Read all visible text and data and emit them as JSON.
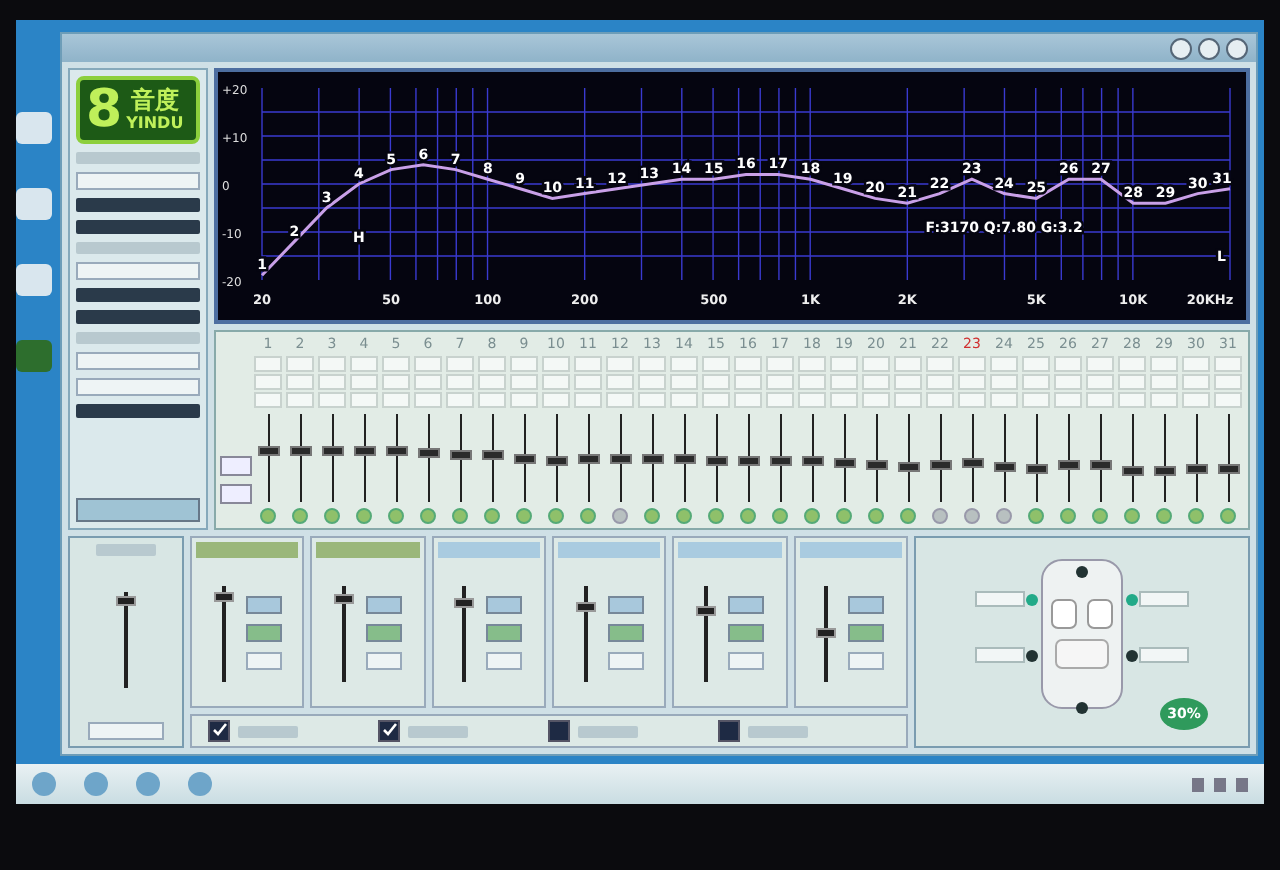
{
  "logo": {
    "digit": "8",
    "name": "音度",
    "latin": "YINDU"
  },
  "eq_chart": {
    "chart_data": {
      "type": "line",
      "categories": [
        "1",
        "2",
        "3",
        "4",
        "5",
        "6",
        "7",
        "8",
        "9",
        "10",
        "11",
        "12",
        "13",
        "14",
        "15",
        "16",
        "17",
        "18",
        "19",
        "20",
        "21",
        "22",
        "23",
        "24",
        "25",
        "26",
        "27",
        "28",
        "29",
        "30",
        "31"
      ],
      "series": [
        {
          "color": "#c9a0e8",
          "values": [
            -19,
            -12,
            -5,
            0,
            3,
            4,
            3,
            1,
            -1,
            -3,
            -2,
            -1,
            0,
            1,
            1,
            2,
            2,
            1,
            -1,
            -3,
            -4,
            -2,
            1,
            -2,
            -3,
            1,
            1,
            -4,
            -4,
            -2,
            -1
          ]
        }
      ],
      "ylim": [
        -20,
        20
      ],
      "grid": true,
      "yticks": [
        {
          "value": 20,
          "label": "+20"
        },
        {
          "value": 10,
          "label": "+10"
        },
        {
          "value": 0,
          "label": "0"
        },
        {
          "value": -10,
          "label": "-10"
        },
        {
          "value": -20,
          "label": "-20"
        }
      ],
      "annotations": [
        "H",
        "F:3170 Q:7.80 G:3.2",
        "L"
      ]
    },
    "frequency_labels": [
      "20",
      "50",
      "100",
      "200",
      "500",
      "1K",
      "2K",
      "5K",
      "10K",
      "20KHz"
    ]
  },
  "bands": [
    {
      "number": "1",
      "selected": false,
      "on": true,
      "level": 0.58
    },
    {
      "number": "2",
      "selected": false,
      "on": true,
      "level": 0.58
    },
    {
      "number": "3",
      "selected": false,
      "on": true,
      "level": 0.58
    },
    {
      "number": "4",
      "selected": false,
      "on": true,
      "level": 0.58
    },
    {
      "number": "5",
      "selected": false,
      "on": true,
      "level": 0.58
    },
    {
      "number": "6",
      "selected": false,
      "on": true,
      "level": 0.57
    },
    {
      "number": "7",
      "selected": false,
      "on": true,
      "level": 0.55
    },
    {
      "number": "8",
      "selected": false,
      "on": true,
      "level": 0.53
    },
    {
      "number": "9",
      "selected": false,
      "on": true,
      "level": 0.5
    },
    {
      "number": "10",
      "selected": false,
      "on": true,
      "level": 0.47
    },
    {
      "number": "11",
      "selected": false,
      "on": true,
      "level": 0.48
    },
    {
      "number": "12",
      "selected": false,
      "on": false,
      "level": 0.48
    },
    {
      "number": "13",
      "selected": false,
      "on": true,
      "level": 0.48
    },
    {
      "number": "14",
      "selected": false,
      "on": true,
      "level": 0.49
    },
    {
      "number": "15",
      "selected": false,
      "on": true,
      "level": 0.47
    },
    {
      "number": "16",
      "selected": false,
      "on": true,
      "level": 0.47
    },
    {
      "number": "17",
      "selected": false,
      "on": true,
      "level": 0.47
    },
    {
      "number": "18",
      "selected": false,
      "on": true,
      "level": 0.45
    },
    {
      "number": "19",
      "selected": false,
      "on": true,
      "level": 0.43
    },
    {
      "number": "20",
      "selected": false,
      "on": true,
      "level": 0.41
    },
    {
      "number": "21",
      "selected": false,
      "on": true,
      "level": 0.39
    },
    {
      "number": "22",
      "selected": false,
      "on": false,
      "level": 0.41
    },
    {
      "number": "23",
      "selected": true,
      "on": false,
      "level": 0.43
    },
    {
      "number": "24",
      "selected": false,
      "on": false,
      "level": 0.38
    },
    {
      "number": "25",
      "selected": false,
      "on": true,
      "level": 0.36
    },
    {
      "number": "26",
      "selected": false,
      "on": true,
      "level": 0.4
    },
    {
      "number": "27",
      "selected": false,
      "on": true,
      "level": 0.4
    },
    {
      "number": "28",
      "selected": false,
      "on": true,
      "level": 0.33
    },
    {
      "number": "29",
      "selected": false,
      "on": true,
      "level": 0.33
    },
    {
      "number": "30",
      "selected": false,
      "on": true,
      "level": 0.35
    },
    {
      "number": "31",
      "selected": false,
      "on": true,
      "level": 0.35
    }
  ],
  "master": {
    "level": 0.95
  },
  "output_channels": [
    {
      "color": "#9ab77a",
      "level": 0.93
    },
    {
      "color": "#9ab77a",
      "level": 0.9
    },
    {
      "color": "#a9cbe0",
      "level": 0.85
    },
    {
      "color": "#a9cbe0",
      "level": 0.8
    },
    {
      "color": "#a9cbe0",
      "level": 0.75
    },
    {
      "color": "#a9cbe0",
      "level": 0.5
    }
  ],
  "checkboxes": [
    {
      "checked": true
    },
    {
      "checked": true
    },
    {
      "checked": false
    },
    {
      "checked": false
    }
  ],
  "speaker_panel": {
    "badge": "30%"
  }
}
